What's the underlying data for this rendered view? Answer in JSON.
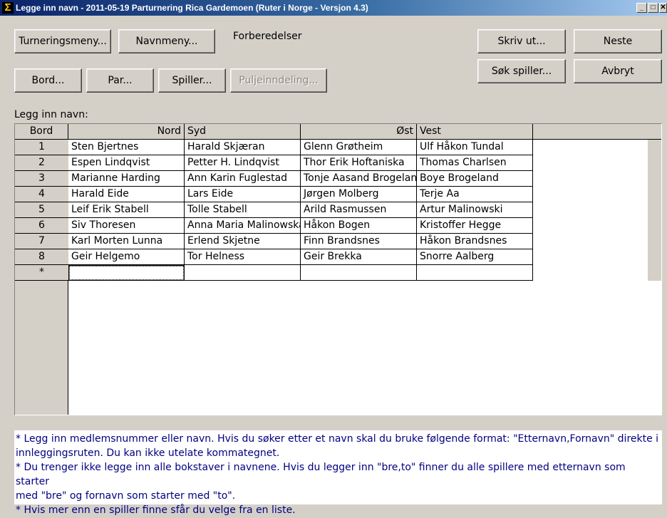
{
  "window": {
    "title": "Legge inn navn - 2011-05-19  Parturnering Rica Gardemoen  (Ruter i Norge - Versjon 4.3)",
    "icon": "sigma-icon",
    "controls": {
      "minimize": "_",
      "maximize": "□",
      "close": "✕"
    }
  },
  "toolbar": {
    "turneringsmeny": "Turneringsmeny...",
    "navnmeny": "Navnmeny...",
    "forberedelser": "Forberedelser",
    "bord": "Bord...",
    "par": "Par...",
    "spiller": "Spiller...",
    "puljeinndeling": "Puljeinndeling...",
    "skriv_ut": "Skriv ut...",
    "neste": "Neste",
    "sok_spiller": "Søk spiller...",
    "avbryt": "Avbryt"
  },
  "grid": {
    "caption": "Legg inn navn:",
    "columns": [
      "Bord",
      "Nord",
      "Syd",
      "Øst",
      "Vest"
    ],
    "rows": [
      {
        "bord": "1",
        "nord": "Sten Bjertnes",
        "syd": "Harald Skjæran",
        "ost": "Glenn Grøtheim",
        "vest": "Ulf Håkon Tundal"
      },
      {
        "bord": "2",
        "nord": "Espen Lindqvist",
        "syd": "Petter H. Lindqvist",
        "ost": "Thor Erik Hoftaniska",
        "vest": "Thomas Charlsen"
      },
      {
        "bord": "3",
        "nord": "Marianne Harding",
        "syd": "Ann Karin Fuglestad",
        "ost": "Tonje Aasand Brogeland",
        "vest": "Boye Brogeland"
      },
      {
        "bord": "4",
        "nord": "Harald Eide",
        "syd": "Lars Eide",
        "ost": "Jørgen Molberg",
        "vest": "Terje Aa"
      },
      {
        "bord": "5",
        "nord": "Leif Erik Stabell",
        "syd": "Tolle Stabell",
        "ost": "Arild Rasmussen",
        "vest": "Artur Malinowski"
      },
      {
        "bord": "6",
        "nord": "Siv Thoresen",
        "syd": "Anna Maria Malinowska",
        "ost": "Håkon Bogen",
        "vest": "Kristoffer Hegge"
      },
      {
        "bord": "7",
        "nord": "Karl Morten Lunna",
        "syd": "Erlend Skjetne",
        "ost": "Finn Brandsnes",
        "vest": "Håkon Brandsnes"
      },
      {
        "bord": "8",
        "nord": "Geir Helgemo",
        "syd": "Tor Helness",
        "ost": "Geir Brekka",
        "vest": "Snorre Aalberg"
      }
    ],
    "new_row_marker": "*"
  },
  "info": {
    "line1": "* Legg inn medlemsnummer eller navn. Hvis du søker etter et navn skal du bruke følgende format: \"Etternavn,Fornavn\" direkte i",
    "line2": "innleggingsruten. Du kan ikke utelate kommategnet.",
    "line3": "* Du trenger ikke legge inn alle bokstaver i navnene. Hvis du legger inn \"bre,to\" finner du alle spillere med etternavn som starter",
    "line4": "med \"bre\" og fornavn som starter med \"to\".",
    "line5": "* Hvis mer enn en spiller finne sfår du velge fra en liste."
  }
}
